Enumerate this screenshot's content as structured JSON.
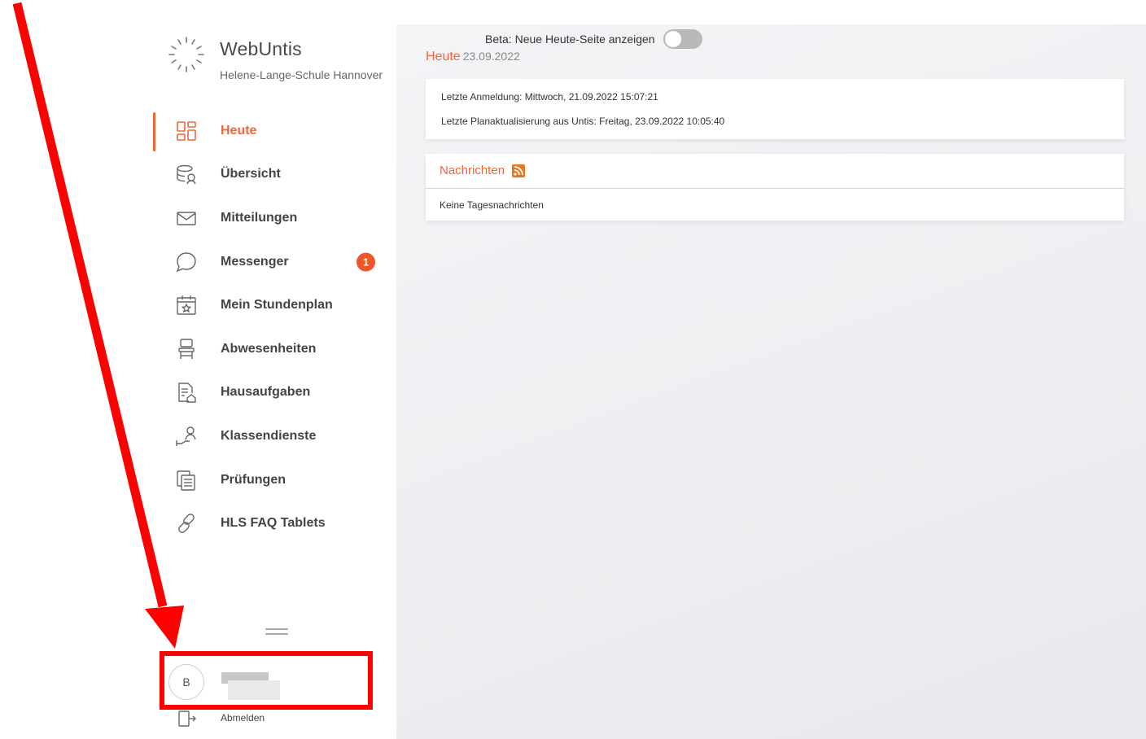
{
  "app": {
    "title": "WebUntis",
    "school": "Helene-Lange-Schule Hannover"
  },
  "sidebar": {
    "items": [
      {
        "label": "Heute",
        "icon": "dashboard-icon",
        "active": true
      },
      {
        "label": "Übersicht",
        "icon": "overview-icon"
      },
      {
        "label": "Mitteilungen",
        "icon": "mail-icon"
      },
      {
        "label": "Messenger",
        "icon": "chat-bubble-icon",
        "badge": "1"
      },
      {
        "label": "Mein Stundenplan",
        "icon": "calendar-star-icon"
      },
      {
        "label": "Abwesenheiten",
        "icon": "chair-icon"
      },
      {
        "label": "Hausaufgaben",
        "icon": "homework-icon"
      },
      {
        "label": "Klassendienste",
        "icon": "class-duty-icon"
      },
      {
        "label": "Prüfungen",
        "icon": "exams-icon"
      },
      {
        "label": "HLS FAQ Tablets",
        "icon": "link-icon"
      }
    ],
    "user": {
      "initial": "B",
      "logout_label": "Abmelden"
    }
  },
  "main": {
    "beta_label": "Beta: Neue Heute-Seite anzeigen",
    "beta_enabled": false,
    "heading": "Heute",
    "date": "23.09.2022",
    "info": {
      "last_login": "Letzte Anmeldung: Mittwoch, 21.09.2022 15:07:21",
      "last_update": "Letzte Planaktualisierung aus Untis: Freitag, 23.09.2022 10:05:40"
    },
    "news": {
      "title": "Nachrichten",
      "empty_text": "Keine Tagesnachrichten"
    }
  },
  "colors": {
    "accent": "#f0663c",
    "badge": "#f0552a",
    "annotation": "#ff0000"
  }
}
